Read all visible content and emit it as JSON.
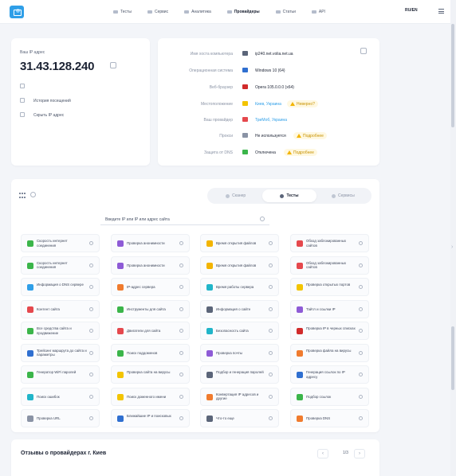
{
  "nav": {
    "items": [
      {
        "label": "Тесты",
        "active": false
      },
      {
        "label": "Сервис",
        "active": false
      },
      {
        "label": "Аналитика",
        "active": false
      },
      {
        "label": "Провайдеры",
        "active": true
      },
      {
        "label": "Статьи",
        "active": false
      },
      {
        "label": "API",
        "active": false
      }
    ],
    "lang": "RU/EN"
  },
  "ip": {
    "label": "Ваш IP адрес",
    "value": "31.43.128.240",
    "links": [
      "История посещений",
      "Скрыть IP адрес"
    ]
  },
  "info": {
    "rows": [
      {
        "label": "Имя хоста компьютера",
        "value": "ip240.net.volia.net.ua",
        "icon_color": "#5b6579"
      },
      {
        "label": "Операционная система",
        "value": "Windows 10 (64)",
        "icon_color": "#2f6fd0"
      },
      {
        "label": "Веб-браузер",
        "value": "Opera 105.0.0.0 (x64)",
        "icon_color": "#d12b2b"
      },
      {
        "label": "Местоположение",
        "value": "Киев, Украина",
        "icon_color": "#f3c400",
        "link": true,
        "warning": "Неверно?"
      },
      {
        "label": "Ваш провайдер",
        "value": "ТриМоб, Украина",
        "icon_color": "#e5484d",
        "link": true
      },
      {
        "label": "Прокси",
        "value": "Не используется",
        "icon_color": "#8a93a5",
        "warning": "Подробнее"
      },
      {
        "label": "Защита от DNS",
        "value": "Отключена",
        "icon_color": "#3bb54a",
        "warning": "Подробнее"
      }
    ]
  },
  "tools": {
    "tabs": [
      {
        "label": "Сканер",
        "active": false
      },
      {
        "label": "Тесты",
        "active": true
      },
      {
        "label": "Сервисы",
        "active": false
      }
    ],
    "search_placeholder": "Введите IP или IP или адрес сайта",
    "items": [
      {
        "label": "Скорость интернет соединения",
        "color": "#3bb54a"
      },
      {
        "label": "Проверка анонимности",
        "color": "#8e5bd6"
      },
      {
        "label": "Время открытия файлов",
        "color": "#f3b400"
      },
      {
        "label": "Обход заблокированных сайтов",
        "color": "#e5484d"
      },
      {
        "label": "Скорость интернет соединения",
        "color": "#3bb54a"
      },
      {
        "label": "Проверка анонимности",
        "color": "#8e5bd6"
      },
      {
        "label": "Время открытия файлов",
        "color": "#f3b400"
      },
      {
        "label": "Обход заблокированных сайтов",
        "color": "#e5484d"
      },
      {
        "label": "Информация о DNS сервере",
        "color": "#2f9fe8"
      },
      {
        "label": "IP-адрес сервера",
        "color": "#f07b2e"
      },
      {
        "label": "Время работы сервера",
        "color": "#21b5c9"
      },
      {
        "label": "Проверка открытых портов",
        "color": "#f3c400"
      },
      {
        "label": "Контент сайта",
        "color": "#e5484d"
      },
      {
        "label": "Инструменты для сайта",
        "color": "#3bb54a"
      },
      {
        "label": "Информация о сайте",
        "color": "#5b6579"
      },
      {
        "label": "Тайтл и ссылки IP",
        "color": "#8e5bd6"
      },
      {
        "label": "Все средства сайта и продвижение",
        "color": "#3bb54a"
      },
      {
        "label": "Двигатели для сайта",
        "color": "#e5484d"
      },
      {
        "label": "Безопасность сайта",
        "color": "#21b5c9"
      },
      {
        "label": "Проверка IP в черных списках",
        "color": "#d12b2b"
      },
      {
        "label": "Трейсинг маршрута до сайта и параметры",
        "color": "#2f6fd0"
      },
      {
        "label": "Поиск поддоменов",
        "color": "#3bb54a"
      },
      {
        "label": "Проверка почты",
        "color": "#8e5bd6"
      },
      {
        "label": "Проверка файла на вирусы",
        "color": "#f07b2e"
      },
      {
        "label": "Генератор WiFi паролей",
        "color": "#3bb54a"
      },
      {
        "label": "Проверка сайта на вирусы",
        "color": "#f3c400"
      },
      {
        "label": "Подбор и генерация паролей",
        "color": "#5b6579"
      },
      {
        "label": "Генерация ссылок по IP адресу",
        "color": "#2f6fd0"
      },
      {
        "label": "Поиск ошибок",
        "color": "#21b5c9"
      },
      {
        "label": "Поиск доменного имени",
        "color": "#f3c400"
      },
      {
        "label": "Конвертация IP адресов и другие",
        "color": "#f07b2e"
      },
      {
        "label": "Подбор ссылок",
        "color": "#3bb54a"
      },
      {
        "label": "Проверка URL",
        "color": "#8a93a5"
      },
      {
        "label": "Ближайшие IP и поисковых",
        "color": "#2f6fd0"
      },
      {
        "label": "Что-то еще",
        "color": "#5b6579"
      },
      {
        "label": "Проверка DNS",
        "color": "#f07b2e"
      }
    ]
  },
  "reviews": {
    "title": "Отзывы о провайдерах г. Киев",
    "page": "1/3"
  }
}
